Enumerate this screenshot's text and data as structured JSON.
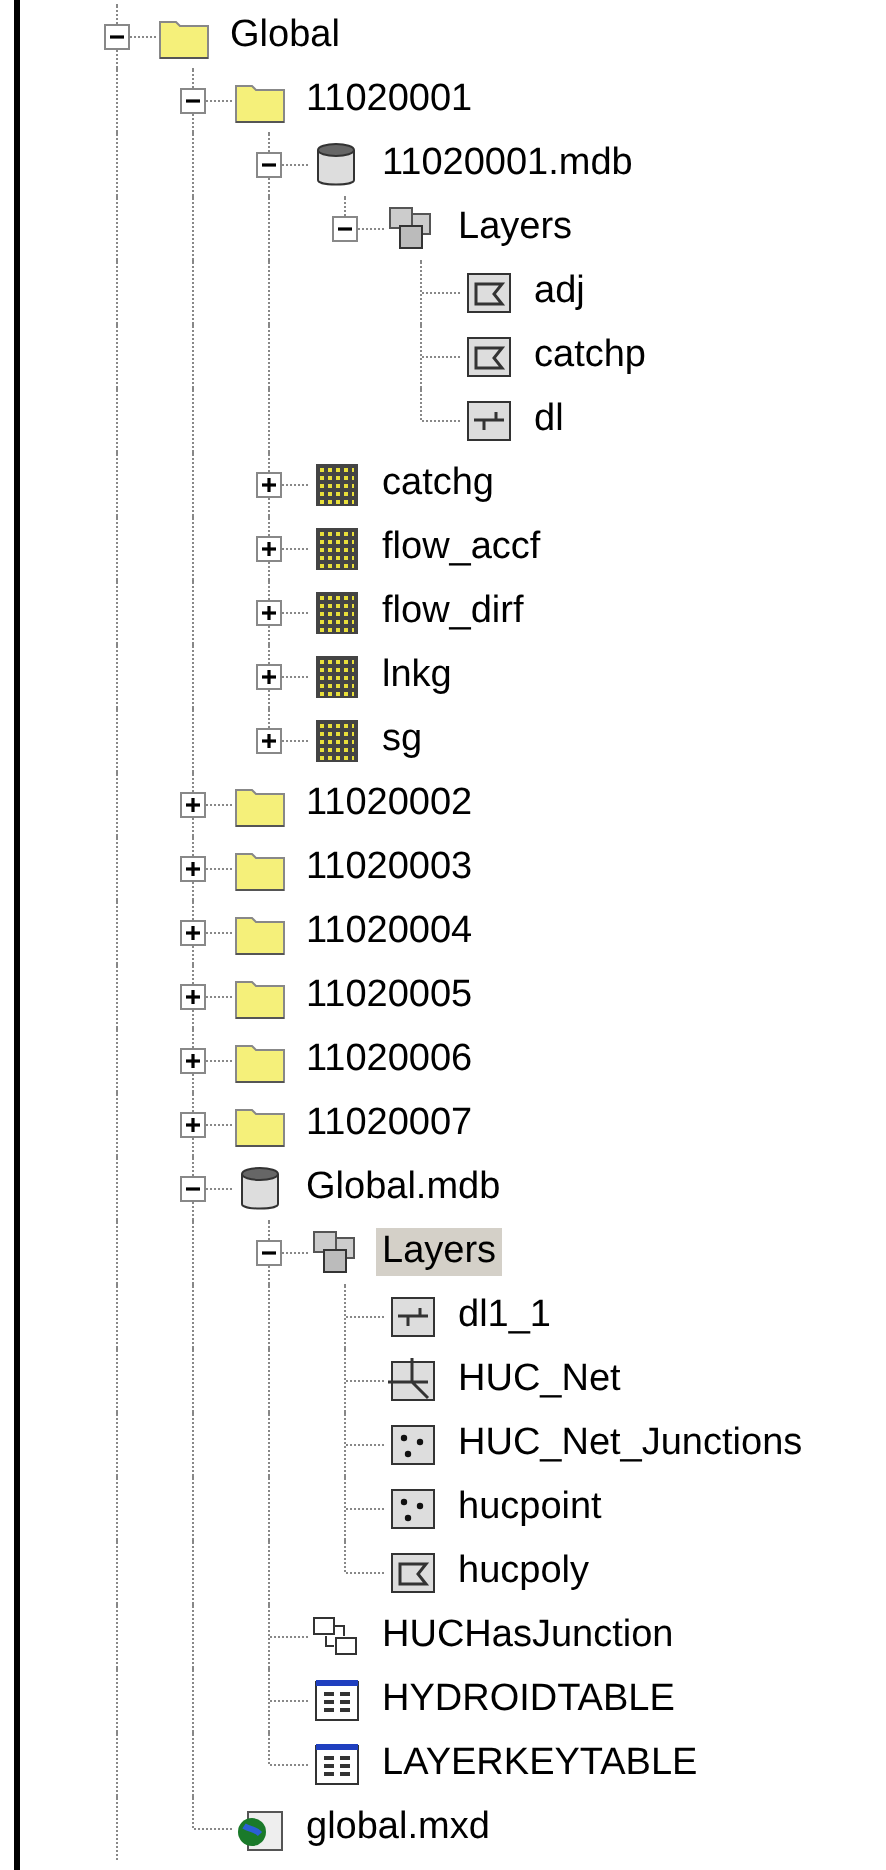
{
  "tree": [
    {
      "label": "Global",
      "kind": "folder",
      "expanded": true,
      "selected": false,
      "children": [
        {
          "label": "11020001",
          "kind": "folder",
          "expanded": true,
          "selected": false,
          "children": [
            {
              "label": "11020001.mdb",
              "kind": "database",
              "expanded": true,
              "selected": false,
              "children": [
                {
                  "label": "Layers",
                  "kind": "layers",
                  "expanded": true,
                  "selected": false,
                  "children": [
                    {
                      "label": "adj",
                      "kind": "polygon",
                      "selected": false
                    },
                    {
                      "label": "catchp",
                      "kind": "polygon",
                      "selected": false
                    },
                    {
                      "label": "dl",
                      "kind": "line",
                      "selected": false
                    }
                  ]
                }
              ]
            },
            {
              "label": "catchg",
              "kind": "raster",
              "expanded": false,
              "selected": false
            },
            {
              "label": "flow_accf",
              "kind": "raster",
              "expanded": false,
              "selected": false
            },
            {
              "label": "flow_dirf",
              "kind": "raster",
              "expanded": false,
              "selected": false
            },
            {
              "label": "lnkg",
              "kind": "raster",
              "expanded": false,
              "selected": false
            },
            {
              "label": "sg",
              "kind": "raster",
              "expanded": false,
              "selected": false
            }
          ]
        },
        {
          "label": "11020002",
          "kind": "folder",
          "expanded": false,
          "selected": false
        },
        {
          "label": "11020003",
          "kind": "folder",
          "expanded": false,
          "selected": false
        },
        {
          "label": "11020004",
          "kind": "folder",
          "expanded": false,
          "selected": false
        },
        {
          "label": "11020005",
          "kind": "folder",
          "expanded": false,
          "selected": false
        },
        {
          "label": "11020006",
          "kind": "folder",
          "expanded": false,
          "selected": false
        },
        {
          "label": "11020007",
          "kind": "folder",
          "expanded": false,
          "selected": false
        },
        {
          "label": "Global.mdb",
          "kind": "database",
          "expanded": true,
          "selected": false,
          "children": [
            {
              "label": "Layers",
              "kind": "layers",
              "expanded": true,
              "selected": true,
              "children": [
                {
                  "label": "dl1_1",
                  "kind": "line",
                  "selected": false
                },
                {
                  "label": "HUC_Net",
                  "kind": "network",
                  "selected": false
                },
                {
                  "label": "HUC_Net_Junctions",
                  "kind": "point",
                  "selected": false
                },
                {
                  "label": "hucpoint",
                  "kind": "point",
                  "selected": false
                },
                {
                  "label": "hucpoly",
                  "kind": "polygon",
                  "selected": false
                }
              ]
            },
            {
              "label": "HUCHasJunction",
              "kind": "relationship",
              "selected": false
            },
            {
              "label": "HYDROIDTABLE",
              "kind": "table",
              "selected": false
            },
            {
              "label": "LAYERKEYTABLE",
              "kind": "table",
              "selected": false
            }
          ]
        },
        {
          "label": "global.mxd",
          "kind": "map",
          "selected": false
        }
      ]
    }
  ]
}
